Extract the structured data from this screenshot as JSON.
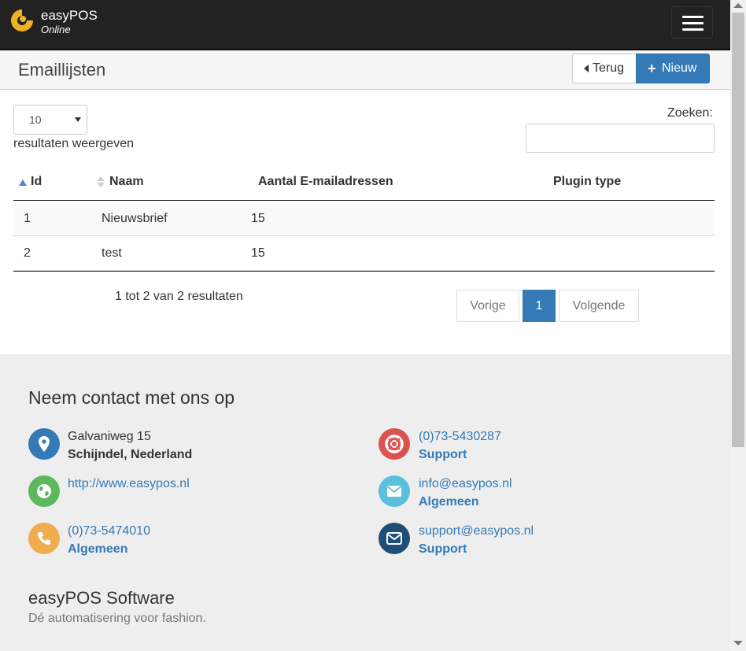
{
  "navbar": {
    "brand": "easyPOS",
    "sub": "Online"
  },
  "header": {
    "title": "Emaillijsten",
    "back_label": "Terug",
    "new_label": "Nieuw"
  },
  "table_controls": {
    "length_value": "10",
    "length_label": "resultaten weergeven",
    "search_label": "Zoeken:",
    "search_value": ""
  },
  "table": {
    "columns": [
      "Id",
      "Naam",
      "Aantal E-mailadressen",
      "Plugin type"
    ],
    "rows": [
      [
        "1",
        "Nieuwsbrief",
        "15",
        ""
      ],
      [
        "2",
        "test",
        "15",
        ""
      ]
    ],
    "info": "1 tot 2 van 2 resultaten",
    "pagination": {
      "prev": "Vorige",
      "current": "1",
      "next": "Volgende"
    }
  },
  "footer": {
    "contact_title": "Neem contact met ons op",
    "address_line1": "Galvaniweg 15",
    "address_line2": "Schijndel, Nederland",
    "website": "http://www.easypos.nl",
    "phone1": "(0)73-5474010",
    "phone1_label": "Algemeen",
    "support_phone": "(0)73-5430287",
    "support_phone_label": "Support",
    "email_info": "info@easypos.nl",
    "email_info_label": "Algemeen",
    "email_support": "support@easypos.nl",
    "email_support_label": "Support",
    "software_title": "easyPOS Software",
    "software_sub": "Dé automatisering voor fashion."
  },
  "colors": {
    "navbar": "#222222",
    "primary": "#337ab7",
    "logo": "#f0b323",
    "address_icon": "#337ab7",
    "web_icon": "#5cb85c",
    "phone_icon": "#f0ad4e",
    "support_icon": "#d9534f",
    "info_mail_icon": "#5bc0de",
    "support_mail_icon": "#1f4e79"
  },
  "icons": [
    "logo-icon",
    "hamburger-icon",
    "caret-left-icon",
    "plus-icon",
    "sort-asc-icon",
    "sort-both-icon",
    "map-marker-icon",
    "globe-icon",
    "phone-icon",
    "lifebuoy-icon",
    "mail-icon",
    "envelope-icon"
  ]
}
